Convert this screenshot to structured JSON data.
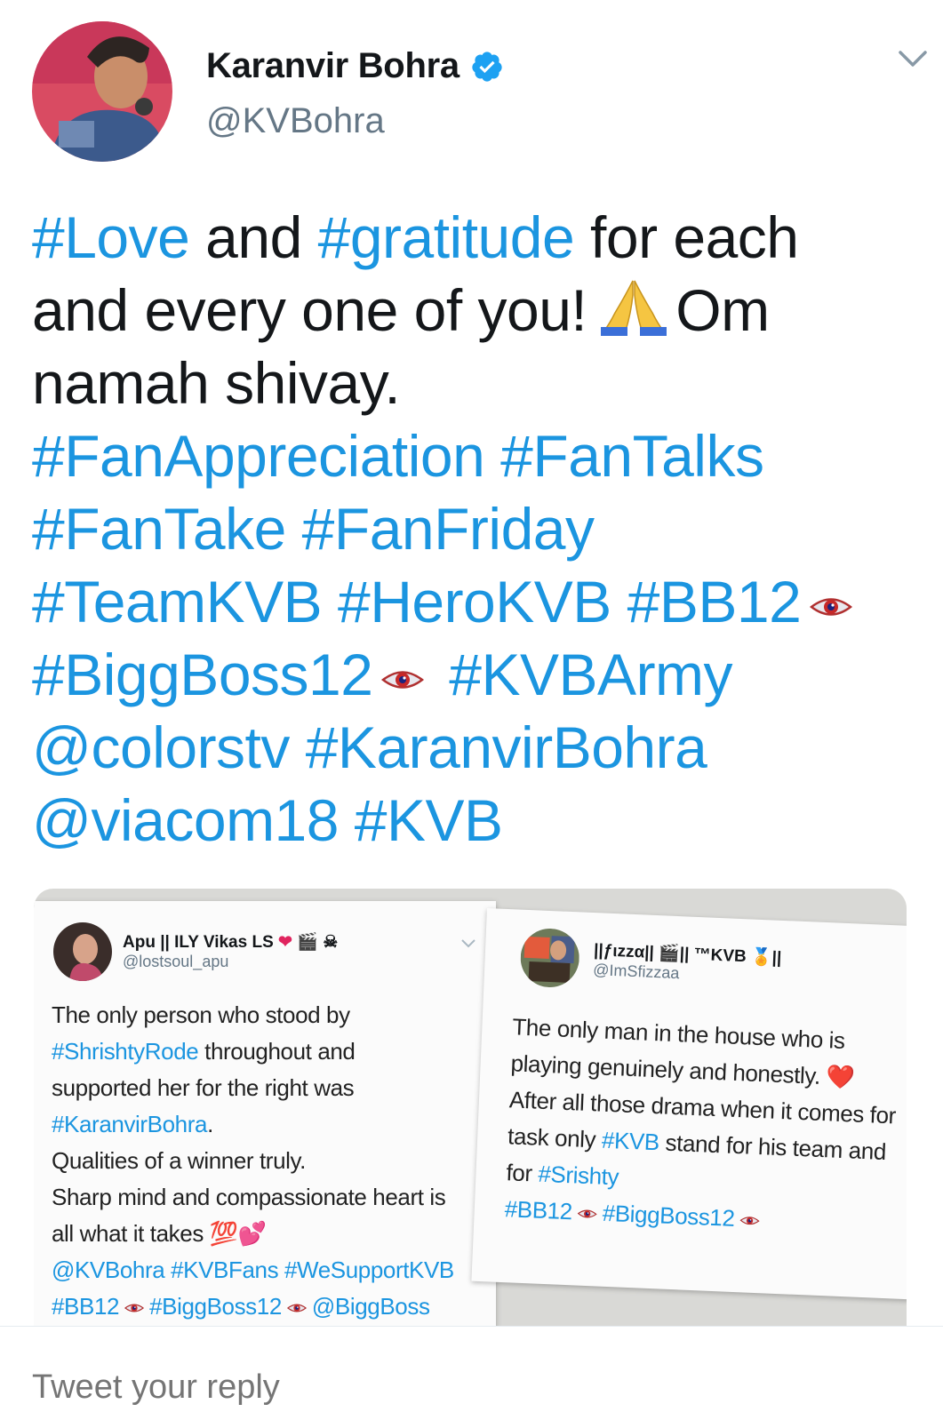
{
  "colors": {
    "link": "#1b95e0",
    "text": "#14171a",
    "secondary": "#657786",
    "verified": "#1da1f2"
  },
  "author": {
    "name": "Karanvir Bohra",
    "handle": "@KVBohra",
    "verified_icon": "verified-badge-icon"
  },
  "tweet": {
    "lines": [
      [
        {
          "t": "#Love",
          "link": true
        },
        {
          "t": " and ",
          "link": false
        },
        {
          "t": "#gratitude",
          "link": true
        },
        {
          "t": " for each",
          "link": false
        }
      ],
      [
        {
          "t": "and every one of you!",
          "link": false
        },
        {
          "icon": "folded-hands-emoji"
        },
        {
          "t": "Om",
          "link": false
        }
      ],
      [
        {
          "t": "namah shivay.",
          "link": false
        }
      ],
      [
        {
          "t": "#FanAppreciation #FanTalks",
          "link": true
        }
      ],
      [
        {
          "t": "#FanTake #FanFriday",
          "link": true
        }
      ],
      [
        {
          "t": "#TeamKVB #HeroKVB #BB12",
          "link": true
        },
        {
          "icon": "eye-emoji"
        }
      ],
      [
        {
          "t": "#BiggBoss12",
          "link": true
        },
        {
          "icon": "eye-emoji"
        },
        {
          "t": " #KVBArmy",
          "link": true
        }
      ],
      [
        {
          "t": "@colorstv #KaranvirBohra",
          "link": true
        }
      ],
      [
        {
          "t": "@viacom18 #KVB",
          "link": true
        }
      ]
    ]
  },
  "embedded_left": {
    "name": "Apu || ILY Vikas LS",
    "handle": "@lostsoul_apu",
    "lines": [
      [
        {
          "t": "The only person who stood by",
          "link": false
        }
      ],
      [
        {
          "t": "#ShrishtyRode",
          "link": true
        },
        {
          "t": " throughout and",
          "link": false
        }
      ],
      [
        {
          "t": "supported her for the right was",
          "link": false
        }
      ],
      [
        {
          "t": "#KaranvirBohra",
          "link": true
        },
        {
          "t": ".",
          "link": false
        }
      ],
      [
        {
          "t": "Qualities of a winner truly.",
          "link": false
        }
      ],
      [
        {
          "t": "Sharp mind and compassionate heart is",
          "link": false
        }
      ],
      [
        {
          "t": "all what it takes 💯💕",
          "link": false
        }
      ],
      [
        {
          "t": "@KVBohra #KVBFans #WeSupportKVB",
          "link": true
        }
      ],
      [
        {
          "t": "#BB12",
          "link": true
        },
        {
          "icon": "eye-emoji"
        },
        {
          "t": "#BiggBoss12",
          "link": true
        },
        {
          "icon": "eye-emoji"
        },
        {
          "t": "@BiggBoss",
          "link": true
        }
      ]
    ]
  },
  "embedded_right": {
    "name": "||ƒιzzα|| 🎬|| ™KVB 🏅||",
    "handle": "@ImSfizzaa",
    "lines": [
      [
        {
          "t": "The only man in the house who is",
          "link": false
        }
      ],
      [
        {
          "t": "playing genuinely and honestly. ❤️",
          "link": false
        }
      ],
      [
        {
          "t": "After all those drama when it comes for",
          "link": false
        }
      ],
      [
        {
          "t": "task only ",
          "link": false
        },
        {
          "t": "#KVB",
          "link": true
        },
        {
          "t": " stand for his team and",
          "link": false
        }
      ],
      [
        {
          "t": "for ",
          "link": false
        },
        {
          "t": "#Srishty",
          "link": true
        }
      ],
      [
        {
          "t": "#BB12",
          "link": true
        },
        {
          "icon": "eye-emoji"
        },
        {
          "t": "#BiggBoss12",
          "link": true
        },
        {
          "icon": "eye-emoji"
        }
      ]
    ]
  },
  "reply": {
    "placeholder": "Tweet your reply"
  }
}
